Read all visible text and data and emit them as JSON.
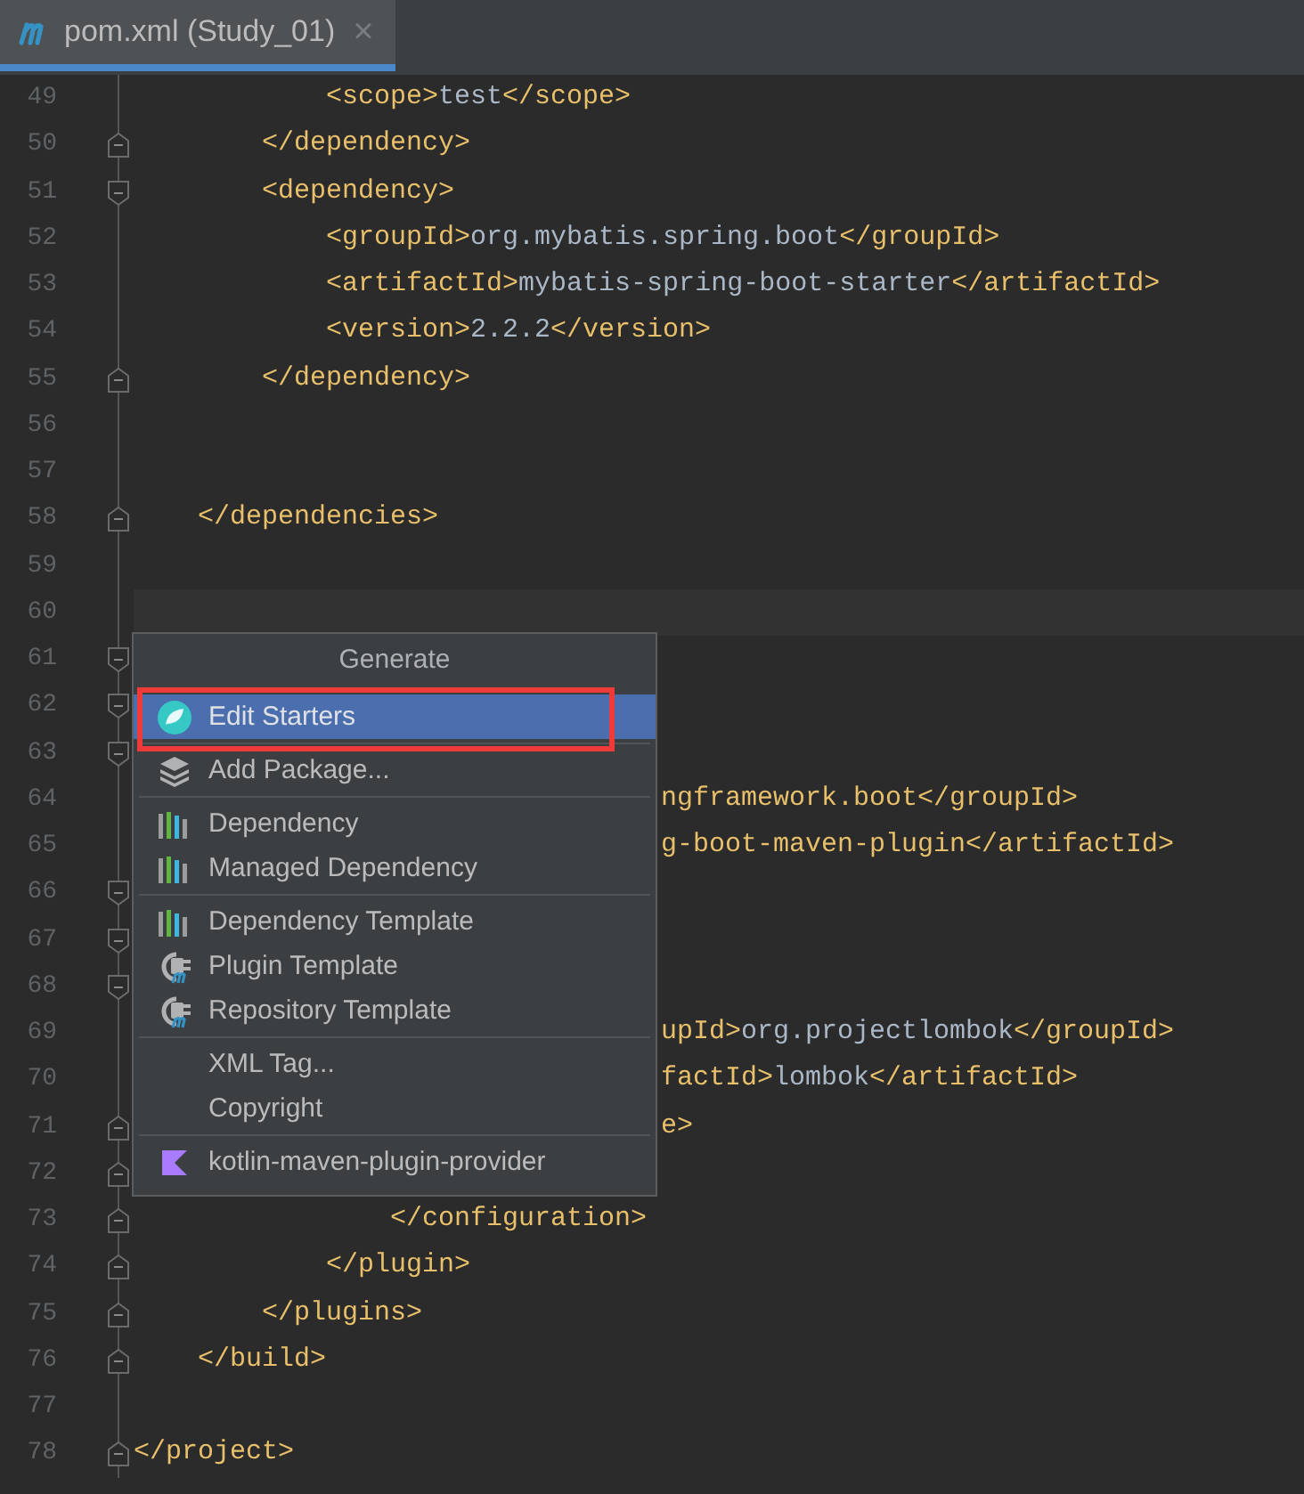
{
  "tab": {
    "title": "pom.xml (Study_01)",
    "close": "×",
    "selected": true
  },
  "editor": {
    "lines": [
      {
        "number": "49",
        "kind": "full",
        "text": "            <scope>test</scope>"
      },
      {
        "number": "50",
        "kind": "full",
        "text": "        </dependency>",
        "fold_end": true
      },
      {
        "number": "51",
        "kind": "full",
        "text": "        <dependency>",
        "fold_start": true
      },
      {
        "number": "52",
        "kind": "full",
        "text": "            <groupId>org.mybatis.spring.boot</groupId>"
      },
      {
        "number": "53",
        "kind": "full",
        "text": "            <artifactId>mybatis-spring-boot-starter</artifactId>"
      },
      {
        "number": "54",
        "kind": "full",
        "text": "            <version>2.2.2</version>"
      },
      {
        "number": "55",
        "kind": "full",
        "text": "        </dependency>",
        "fold_end": true
      },
      {
        "number": "56",
        "kind": "full"
      },
      {
        "number": "57",
        "kind": "full"
      },
      {
        "number": "58",
        "kind": "full",
        "text": "    </dependencies>",
        "fold_end": true
      },
      {
        "number": "59",
        "kind": "full"
      },
      {
        "number": "60",
        "kind": "full",
        "current": true
      },
      {
        "number": "61",
        "kind": "full",
        "fold_start": true
      },
      {
        "number": "62",
        "kind": "full",
        "fold_start": true
      },
      {
        "number": "63",
        "kind": "full",
        "fold_start": true
      },
      {
        "number": "64",
        "kind": "partial",
        "text": "ngframework.boot</groupId>"
      },
      {
        "number": "65",
        "kind": "partial",
        "text": "g-boot-maven-plugin</artifactId>"
      },
      {
        "number": "66",
        "kind": "full",
        "fold_start": true
      },
      {
        "number": "67",
        "kind": "full",
        "fold_start": true
      },
      {
        "number": "68",
        "kind": "full",
        "fold_start": true
      },
      {
        "number": "69",
        "kind": "partial",
        "text": "upId>org.projectlombok</groupId>"
      },
      {
        "number": "70",
        "kind": "partial",
        "text": "factId>lombok</artifactId>"
      },
      {
        "number": "71",
        "kind": "partial",
        "text": "e>",
        "fold_end": true
      },
      {
        "number": "72",
        "kind": "full",
        "fold_end": true
      },
      {
        "number": "73",
        "kind": "full",
        "text": "                </configuration>",
        "fold_end": true
      },
      {
        "number": "74",
        "kind": "full",
        "text": "            </plugin>",
        "fold_end": true
      },
      {
        "number": "75",
        "kind": "full",
        "text": "        </plugins>",
        "fold_end": true
      },
      {
        "number": "76",
        "kind": "full",
        "text": "    </build>",
        "fold_end": true
      },
      {
        "number": "77",
        "kind": "full"
      },
      {
        "number": "78",
        "kind": "full",
        "text": "</project>",
        "fold_end": true
      }
    ]
  },
  "popup": {
    "title": "Generate",
    "groups": [
      [
        {
          "label": "Edit Starters",
          "kind": "leaf",
          "selected": true,
          "marked": true
        }
      ],
      [
        {
          "label": "Add Package...",
          "kind": "layers",
          "selected": false,
          "marked": false
        }
      ],
      [
        {
          "label": "Dependency",
          "kind": "bars",
          "selected": false,
          "marked": false
        },
        {
          "label": "Managed Dependency",
          "kind": "bars",
          "selected": false,
          "marked": false
        }
      ],
      [
        {
          "label": "Dependency Template",
          "kind": "bars",
          "selected": false,
          "marked": false
        },
        {
          "label": "Plugin Template",
          "kind": "plug",
          "selected": false,
          "marked": false
        },
        {
          "label": "Repository Template",
          "kind": "plug",
          "selected": false,
          "marked": false
        }
      ],
      [
        {
          "label": "XML Tag...",
          "kind": "none",
          "selected": false,
          "marked": false
        },
        {
          "label": "Copyright",
          "kind": "none",
          "selected": false,
          "marked": false
        }
      ],
      [
        {
          "label": "kotlin-maven-plugin-provider",
          "kind": "kotlin",
          "selected": false,
          "marked": false
        }
      ]
    ]
  }
}
